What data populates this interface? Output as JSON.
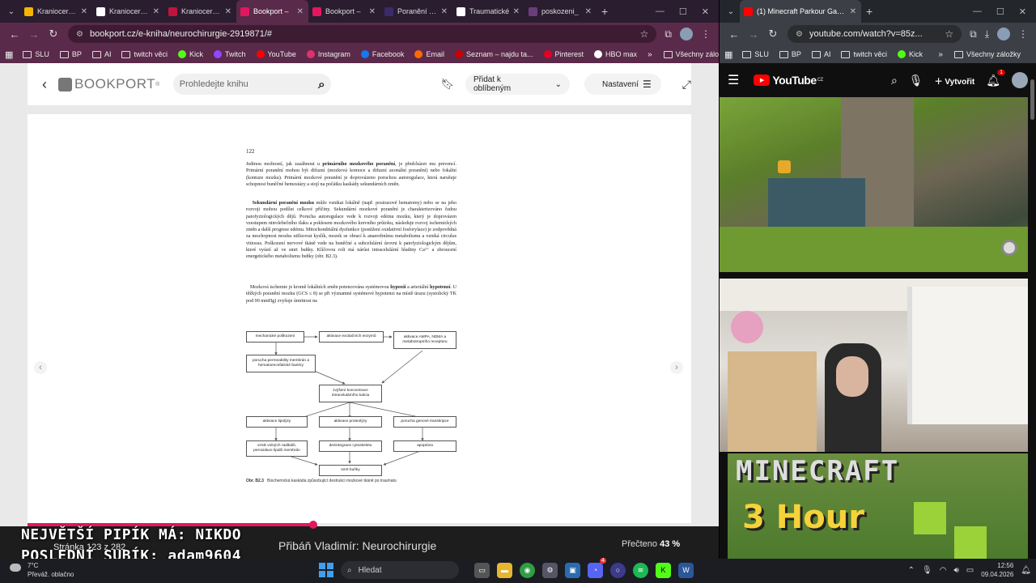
{
  "left_browser": {
    "tabs": [
      {
        "title": "Kraniocerebr",
        "color": "#f5b400"
      },
      {
        "title": "Kraniocerebr",
        "color": "#ffffff"
      },
      {
        "title": "Kraniocerebr",
        "color": "#c0143c"
      },
      {
        "title": "Bookport – ",
        "color": "#e3175e",
        "active": true
      },
      {
        "title": "Bookport – ",
        "color": "#e3175e"
      },
      {
        "title": "Poranění hla",
        "color": "#3b2b6b"
      },
      {
        "title": "Traumatické",
        "color": "#ffffff"
      },
      {
        "title": "poskozeni_",
        "color": "#6b3e7a"
      }
    ],
    "url": "bookport.cz/e-kniha/neurochirurgie-2919871/#",
    "bookmarks": [
      {
        "label": "SLU",
        "type": "folder"
      },
      {
        "label": "BP",
        "type": "folder"
      },
      {
        "label": "AI",
        "type": "folder"
      },
      {
        "label": "twitch věci",
        "type": "folder"
      },
      {
        "label": "Kick",
        "type": "logo",
        "color": "#53fc18"
      },
      {
        "label": "Twitch",
        "type": "logo",
        "color": "#9146ff"
      },
      {
        "label": "YouTube",
        "type": "logo",
        "color": "#ff0000"
      },
      {
        "label": "Instagram",
        "type": "logo",
        "color": "#e1306c"
      },
      {
        "label": "Facebook",
        "type": "logo",
        "color": "#1877f2"
      },
      {
        "label": "Email",
        "type": "logo",
        "color": "#ff6a00"
      },
      {
        "label": "Seznam – najdu ta...",
        "type": "logo",
        "color": "#cc0000"
      },
      {
        "label": "Pinterest",
        "type": "logo",
        "color": "#e60023"
      },
      {
        "label": "HBO max",
        "type": "logo",
        "color": "#ffffff"
      }
    ],
    "bookmarks_more": "»",
    "all_bookmarks": "Všechny záložky"
  },
  "right_browser": {
    "tabs": [
      {
        "title": "(1) Minecraft Parkour Gameplay",
        "color": "#ff0000",
        "active": true
      }
    ],
    "url": "youtube.com/watch?v=85z...",
    "bookmarks": [
      {
        "label": "SLU",
        "type": "folder"
      },
      {
        "label": "BP",
        "type": "folder"
      },
      {
        "label": "AI",
        "type": "folder"
      },
      {
        "label": "twitch věci",
        "type": "folder"
      },
      {
        "label": "Kick",
        "type": "logo",
        "color": "#53fc18"
      }
    ],
    "bookmarks_more": "»",
    "all_bookmarks": "Všechny záložky"
  },
  "bookport": {
    "logo": "BOOKPORT",
    "search_placeholder": "Prohledejte knihu",
    "favorite_label": "Přidat k oblíbeným",
    "settings_label": "Nastavení",
    "page_number": "122",
    "paragraph1_parts": [
      "Jedinou možností, jak zasáhnout u ",
      "primárního mozkového poranění",
      ", je předcházet mu prevencí. Primární poranění mohou být difuzní (mozková komoce a difuzní axonální poranění) nebo fokální (kontuze mozku). Primární mozkové poranění je doprovázeno poruchou autoregulace, která narušuje schopnost buněčné hemostázy a stojí na počátku kaskády sekundárních změn."
    ],
    "paragraph2_parts": [
      "Sekundární poranění mozku",
      " může vznikat lokálně (např. posirazové hematomy) nebo se na jeho rozvoji mohou podílet celkové příčiny. Sekundární mozkové poranění je charakterizováno řadou patofyziologických dějů. Porucha autoregulace vede k rozvoji edému mozku, který je doprovázen vzestupem nitrolebečního tlaku a poklesem mozkového krevního průtoku, následuje rozvoj ischemických změn a další progrese edému. Mitochondriální dysfunkce (postižení oxidativní fosforylace) je zodpovědná za neschopnost mozku utilizovat kyslík, mozek se obrací k anaerobnímu metabolismu a vzniká circulus vitiosus. Poškození nervové tkáně vede na buněčné a subcelulární úrovni k patofyziologickým dějům, které vyústí až ve smrt buňky. Klíčovou roli má nárůst intracelulární hladiny Ca²⁺ a zhroucení energetického metabolismu buňky (obr. B2.3)."
    ],
    "paragraph3_parts": [
      "Mozková ischemie je kromě lokálních změn potencována systémovou ",
      "hypoxií",
      " a arteriální ",
      "hypotenzí",
      ". U těžkých poranění mozku (GCS ≤ 8) se při významné systémové hypotenzi na místě úrazu (systolický TK pod 90 mmHg) zvyšuje úmrtnost na"
    ],
    "diagram_nodes": {
      "n1": "mechanické poškození",
      "n2": "aktivace excitačních enzymů",
      "n3": "aktivace AMPA, NDMA a metabotropního receptoru",
      "n4": "porucha permeability membrán a hematoencefalické bariéry",
      "n5": "zvýšení koncentrace intracelulárního kalcia",
      "n6": "aktivace lipolýzy",
      "n7": "aktivace proteolýzy",
      "n8": "porucha genové transkripce",
      "n9": "vznik volných radikálů, peroxidace lipidů membrán",
      "n10": "dezintegrace cytoskeletu",
      "n11": "apoptóza",
      "n12": "smrt buňky"
    },
    "caption_label": "Obr. B2.3",
    "caption_text": "Biochemická kaskáda způsobující destrukci mozkové tkáně po traumatu",
    "page_counter": "Stránka 123 z 282",
    "book_title": "Přibáň Vladimír: Neurochirurgie",
    "read_label": "Přečteno",
    "read_percent": "43 %",
    "progress_fraction": 0.43
  },
  "stream_overlay": {
    "line1": "NEJVĚTŠÍ PIPÍK MÁ: NIKDO",
    "line2": "POSLEDNÍ SUBÍK: adam9604"
  },
  "youtube": {
    "logo": "YouTube",
    "country": "CZ",
    "create_label": "Vytvořit",
    "notification_count": "1",
    "thumbnail_title": "MINECRAFT",
    "thumbnail_subtitle": "3 Hour"
  },
  "taskbar": {
    "weather_temp": "7°C",
    "weather_desc": "Převáž. oblačno",
    "search_label": "Hledat",
    "time": "12:56",
    "date": "09.04.2026",
    "discord_badge": "4"
  }
}
